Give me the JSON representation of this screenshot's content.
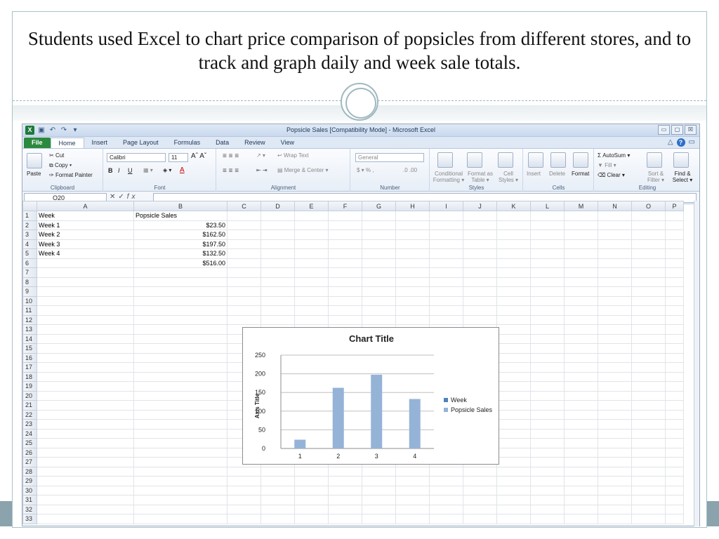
{
  "slide": {
    "title": "Students used Excel to chart price comparison of popsicles from different stores, and  to track and graph daily and week sale totals."
  },
  "window": {
    "title": "Popsicle Sales  [Compatibility Mode] - Microsoft Excel",
    "controls": [
      "▭",
      "▢",
      "☒"
    ]
  },
  "tabs": [
    {
      "label": "File",
      "kind": "file"
    },
    {
      "label": "Home",
      "kind": "active"
    },
    {
      "label": "Insert",
      "kind": ""
    },
    {
      "label": "Page Layout",
      "kind": ""
    },
    {
      "label": "Formulas",
      "kind": ""
    },
    {
      "label": "Data",
      "kind": ""
    },
    {
      "label": "Review",
      "kind": ""
    },
    {
      "label": "View",
      "kind": ""
    }
  ],
  "ribbon": {
    "clipboard": {
      "paste": "Paste",
      "cut": "Cut",
      "copy": "Copy ▾",
      "format_painter": "Format Painter",
      "label": "Clipboard"
    },
    "font": {
      "name": "Calibri",
      "size": "11",
      "label": "Font"
    },
    "alignment": {
      "wrap": "Wrap Text",
      "merge": "Merge & Center ▾",
      "label": "Alignment"
    },
    "number": {
      "format": "General",
      "currency": "$ ▾ %  ,",
      "decimals": ".0 .00",
      "label": "Number"
    },
    "styles": {
      "conditional": "Conditional Formatting ▾",
      "format_table": "Format as Table ▾",
      "cell_styles": "Cell Styles ▾",
      "label": "Styles"
    },
    "cells": {
      "insert": "Insert",
      "delete": "Delete",
      "format": "Format",
      "label": "Cells"
    },
    "editing": {
      "autosum": "AutoSum ▾",
      "fill": "Fill ▾",
      "clear": "Clear ▾",
      "sort": "Sort & Filter ▾",
      "find": "Find & Select ▾",
      "label": "Editing"
    }
  },
  "formula_bar": {
    "cell_ref": "O20",
    "fx": "fx"
  },
  "grid": {
    "columns": [
      "A",
      "B",
      "C",
      "D",
      "E",
      "F",
      "G",
      "H",
      "I",
      "J",
      "K",
      "L",
      "M",
      "N",
      "O",
      "P"
    ],
    "row_count": 33,
    "cells": [
      [
        "Week",
        "Popsicle Sales"
      ],
      [
        "Week 1",
        "$23.50"
      ],
      [
        "Week 2",
        "$162.50"
      ],
      [
        "Week 3",
        "$197.50"
      ],
      [
        "Week 4",
        "$132.50"
      ],
      [
        "",
        "$516.00"
      ]
    ]
  },
  "chart_data": {
    "type": "bar",
    "title": "Chart Title",
    "xlabel": "",
    "ylabel": "Axis Title",
    "categories": [
      "1",
      "2",
      "3",
      "4"
    ],
    "series": [
      {
        "name": "Week",
        "values": [],
        "color": "#4f81bd"
      },
      {
        "name": "Popsicle Sales",
        "values": [
          23.5,
          162.5,
          197.5,
          132.5
        ],
        "color": "#95b3d7"
      }
    ],
    "ylim": [
      0,
      250
    ],
    "yticks": [
      0,
      50,
      100,
      150,
      200,
      250
    ],
    "grid": true,
    "legend": "right"
  }
}
